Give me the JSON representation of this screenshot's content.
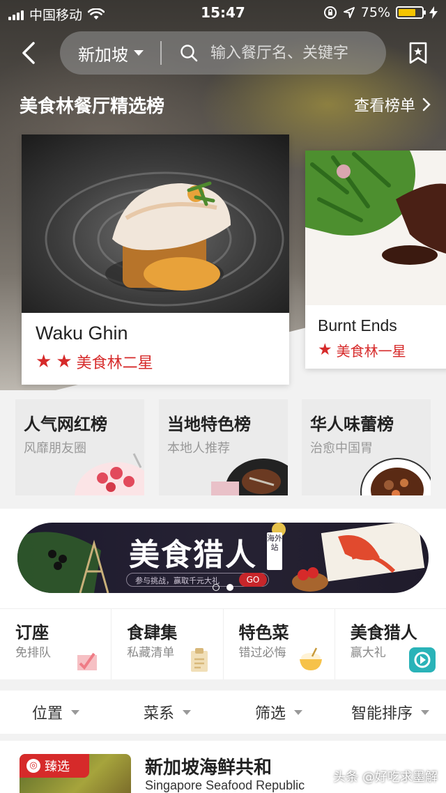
{
  "status_bar": {
    "carrier": "中国移动",
    "time": "15:47",
    "battery_percent": "75%",
    "battery_level": 0.75,
    "icons": [
      "signal-icon",
      "wifi-icon",
      "rotation-lock-icon",
      "location-icon",
      "battery-icon",
      "charging-icon"
    ]
  },
  "nav": {
    "city": "新加坡",
    "search_placeholder": "输入餐厅名、关键字",
    "icons": [
      "back-icon",
      "search-icon",
      "bookmark-icon",
      "caret-down-icon"
    ]
  },
  "section": {
    "title": "美食林餐厅精选榜",
    "more_label": "查看榜单"
  },
  "restaurants": [
    {
      "name": "Waku Ghin",
      "stars": 2,
      "rating_label": "美食林二星"
    },
    {
      "name": "Burnt Ends",
      "stars": 1,
      "rating_label": "美食林一星"
    }
  ],
  "rank_lists": [
    {
      "title": "人气网红榜",
      "subtitle": "风靡朋友圈"
    },
    {
      "title": "当地特色榜",
      "subtitle": "本地人推荐"
    },
    {
      "title": "华人味蕾榜",
      "subtitle": "治愈中国胃"
    }
  ],
  "banner": {
    "title": "美食猎人",
    "tag": "海外站",
    "subtitle": "参与挑战，赢取千元大礼",
    "go_label": "GO",
    "page_count": 2,
    "active_page": 2
  },
  "entries": [
    {
      "title": "订座",
      "subtitle": "免排队",
      "icon": "booking-icon"
    },
    {
      "title": "食肆集",
      "subtitle": "私藏清单",
      "icon": "clipboard-icon"
    },
    {
      "title": "特色菜",
      "subtitle": "错过必悔",
      "icon": "rice-bowl-icon"
    },
    {
      "title": "美食猎人",
      "subtitle": "赢大礼",
      "icon": "video-icon"
    }
  ],
  "filters": [
    {
      "label": "位置"
    },
    {
      "label": "菜系"
    },
    {
      "label": "筛选"
    },
    {
      "label": "智能排序"
    }
  ],
  "list": [
    {
      "badge": "臻选",
      "title": "新加坡海鲜共和",
      "subtitle": "Singapore Seafood Republic"
    }
  ],
  "watermark": "头条 @好吃求墨解",
  "colors": {
    "accent_red": "#d62a2a",
    "battery_yellow": "#f5c400"
  }
}
